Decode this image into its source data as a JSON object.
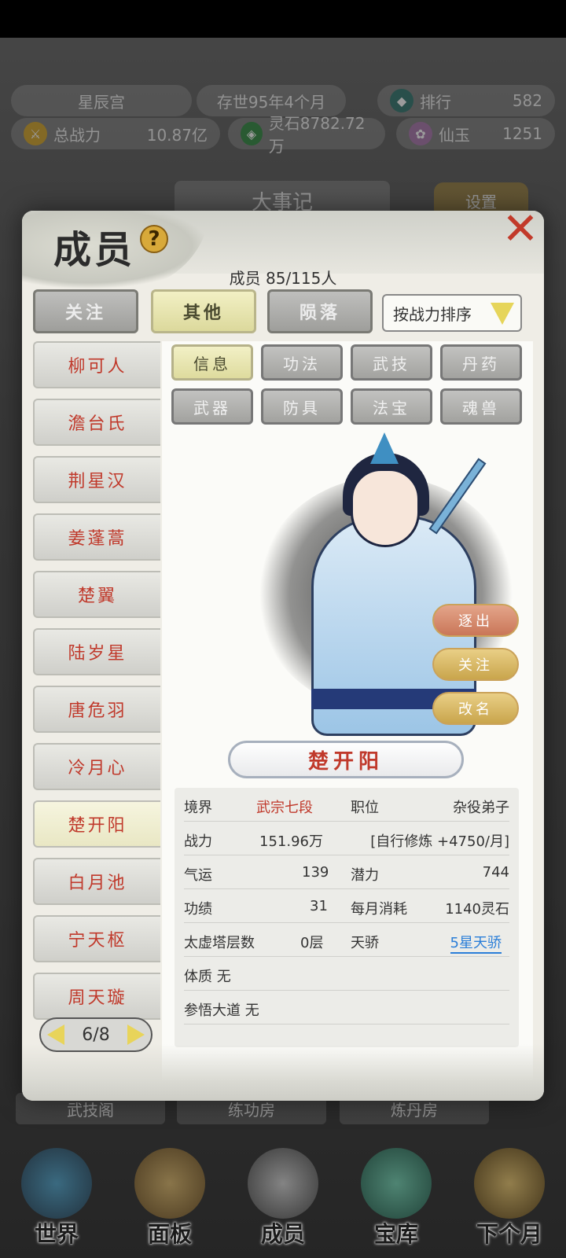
{
  "hud": {
    "sect_name": "星辰宫",
    "duration": "存世95年4个月",
    "rank_label": "排行",
    "rank_value": "582",
    "power_label": "总战力",
    "power_value": "10.87亿",
    "spirit_stones": "灵石8782.72万",
    "jade_label": "仙玉",
    "jade_value": "1251",
    "events_label": "大事记",
    "settings_label": "设置"
  },
  "modal": {
    "title": "成员",
    "help_icon": "?",
    "close_icon": "✕",
    "members_count": "成员  85/115人",
    "tabs": [
      {
        "label": "关注",
        "active": false
      },
      {
        "label": "其他",
        "active": true
      },
      {
        "label": "陨落",
        "active": false
      }
    ],
    "sort_label": "按战力排序"
  },
  "members": [
    {
      "name": "柳可人",
      "active": false
    },
    {
      "name": "澹台氏",
      "active": false
    },
    {
      "name": "荆星汉",
      "active": false
    },
    {
      "name": "姜蓬蒿",
      "active": false
    },
    {
      "name": "楚翼",
      "active": false
    },
    {
      "name": "陆岁星",
      "active": false
    },
    {
      "name": "唐危羽",
      "active": false
    },
    {
      "name": "冷月心",
      "active": false
    },
    {
      "name": "楚开阳",
      "active": true
    },
    {
      "name": "白月池",
      "active": false
    },
    {
      "name": "宁天枢",
      "active": false
    },
    {
      "name": "周天璇",
      "active": false
    }
  ],
  "pager": {
    "text": "6/8"
  },
  "sub_tabs": [
    {
      "label": "信息",
      "active": true
    },
    {
      "label": "功法",
      "active": false
    },
    {
      "label": "武技",
      "active": false
    },
    {
      "label": "丹药",
      "active": false
    },
    {
      "label": "武器",
      "active": false
    },
    {
      "label": "防具",
      "active": false
    },
    {
      "label": "法宝",
      "active": false
    },
    {
      "label": "魂兽",
      "active": false
    }
  ],
  "actions": {
    "expel": "逐出",
    "follow": "关注",
    "rename": "改名"
  },
  "selected_name": "楚开阳",
  "info": {
    "realm_label": "境界",
    "realm_value": "武宗七段",
    "position_label": "职位",
    "position_value": "杂役弟子",
    "combat_label": "战力",
    "combat_value": "151.96万",
    "cultivation_text": "[自行修炼  +4750/月]",
    "luck_label": "气运",
    "luck_value": "139",
    "potential_label": "潜力",
    "potential_value": "744",
    "merit_label": "功绩",
    "merit_value": "31",
    "cost_label": "每月消耗",
    "cost_value": "1140灵石",
    "tower_label": "太虚塔层数",
    "tower_value": "0层",
    "talent_label": "天骄",
    "talent_value": "5星天骄",
    "physique_text": "体质 无",
    "dao_text": "参悟大道 无"
  },
  "bottom_nav": [
    {
      "label": "世界"
    },
    {
      "label": "面板"
    },
    {
      "label": "成员"
    },
    {
      "label": "宝库"
    },
    {
      "label": "下个月"
    }
  ],
  "background_buildings": [
    "武技阁",
    "练功房",
    "炼丹房"
  ],
  "colors": {
    "accent_red": "#c0392b",
    "gold": "#d8a93a",
    "link_blue": "#2a7ed8"
  }
}
